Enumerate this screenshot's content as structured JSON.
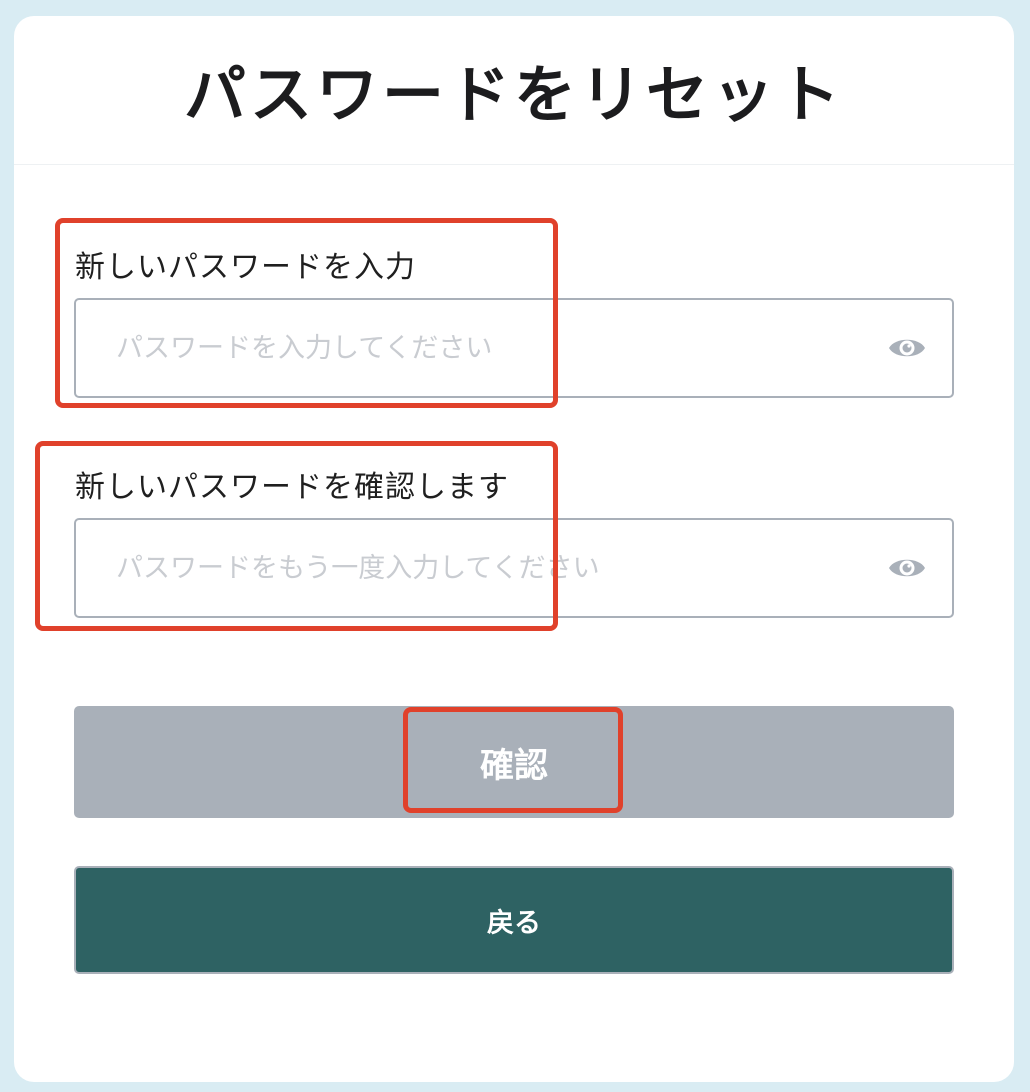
{
  "page": {
    "title": "パスワードをリセット"
  },
  "new_password": {
    "label": "新しいパスワードを入力",
    "placeholder": "パスワードを入力してください",
    "value": "",
    "toggle_icon": "eye-icon"
  },
  "confirm_password": {
    "label": "新しいパスワードを確認します",
    "placeholder": "パスワードをもう一度入力してください",
    "value": "",
    "toggle_icon": "eye-icon"
  },
  "buttons": {
    "confirm_label": "確認",
    "back_label": "戻る"
  },
  "colors": {
    "background": "#d9ecf3",
    "disabled_button": "#a9b0b9",
    "primary_button": "#2e6263",
    "icon": "#a9b0b9",
    "annotation": "#e0412b"
  }
}
